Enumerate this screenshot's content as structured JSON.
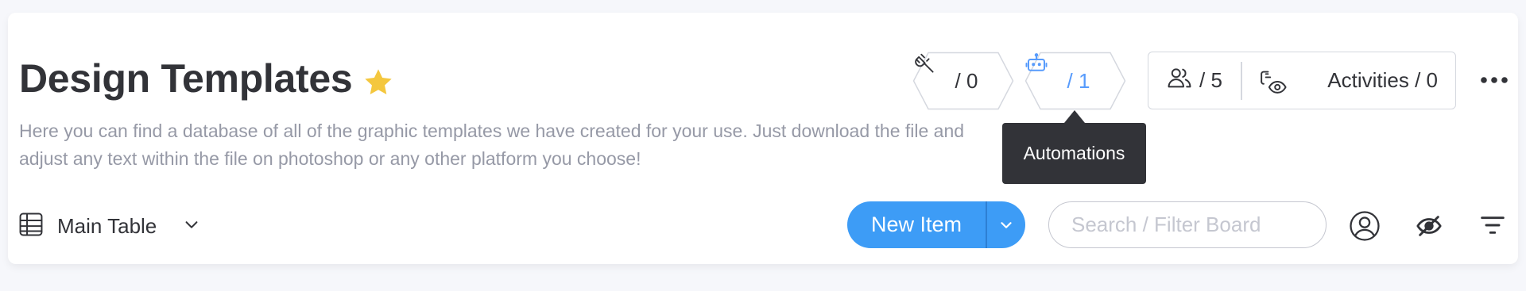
{
  "board": {
    "title": "Design Templates",
    "favorite_icon": "star-icon",
    "description": "Here you can find a database of all of the graphic templates we have created for your use. Just download the file and adjust any text within the file on photoshop or any other platform you choose!"
  },
  "header_actions": {
    "integrations": {
      "icon": "plug-icon",
      "count": "/ 0"
    },
    "automations": {
      "icon": "robot-icon",
      "count": "/ 1"
    },
    "members": {
      "icon": "people-icon",
      "count": "/ 5"
    },
    "activities": {
      "icon": "activity-eye-icon",
      "label": "Activities / 0"
    },
    "more": {
      "icon": "more-dots-icon"
    }
  },
  "tooltip": {
    "text": "Automations"
  },
  "toolbar": {
    "view": {
      "icon": "table-icon",
      "label": "Main Table",
      "dropdown_icon": "chevron-down-icon"
    },
    "new_item": {
      "label": "New Item",
      "dropdown_icon": "chevron-down-icon"
    },
    "search": {
      "placeholder": "Search / Filter Board",
      "value": ""
    },
    "person_filter": {
      "icon": "person-icon"
    },
    "hide_columns": {
      "icon": "eye-off-icon"
    },
    "filter": {
      "icon": "filter-icon"
    }
  },
  "colors": {
    "primary": "#3d9cf6",
    "automation_accent": "#579bfc",
    "star": "#f4c73e",
    "text": "#323338",
    "muted_text": "#9699a6",
    "tooltip_bg": "#323338"
  }
}
